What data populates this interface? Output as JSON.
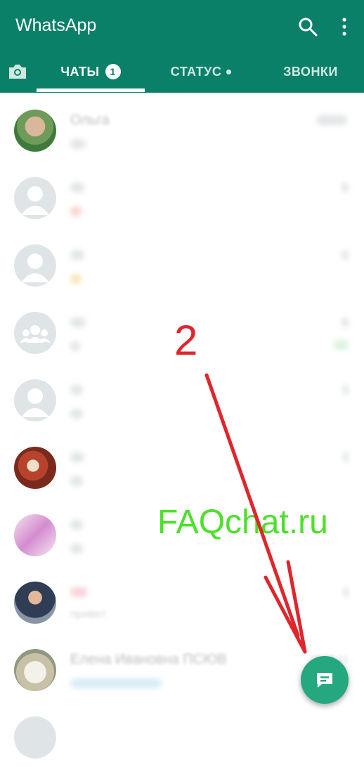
{
  "app": {
    "title": "WhatsApp"
  },
  "tabs": [
    {
      "label": "ЧАТЫ",
      "badge": "1"
    },
    {
      "label": "СТАТУС"
    },
    {
      "label": "ЗВОНКИ"
    }
  ],
  "chats": [
    {
      "name": "Ольга",
      "time": ""
    },
    {
      "name": "",
      "time": ""
    },
    {
      "name": "",
      "time": ""
    },
    {
      "name": "",
      "time": ""
    },
    {
      "name": "",
      "time": ""
    },
    {
      "name": "",
      "time": ""
    },
    {
      "name": "",
      "time": ""
    },
    {
      "name": "",
      "time": "",
      "message": "привет"
    },
    {
      "name": "Елена Ивановна ПСЮВ",
      "time": "18.10.21",
      "message": ""
    }
  ],
  "overlay": {
    "step_number": "2",
    "watermark": "FAQchat.ru"
  },
  "colors": {
    "primary": "#0a8069",
    "fab": "#25a880",
    "annotation": "#e0252b",
    "watermark": "#4ce02a"
  },
  "icons": {
    "search": "search-icon",
    "more": "more-vert-icon",
    "camera": "camera-icon",
    "new_chat": "chat-icon"
  }
}
